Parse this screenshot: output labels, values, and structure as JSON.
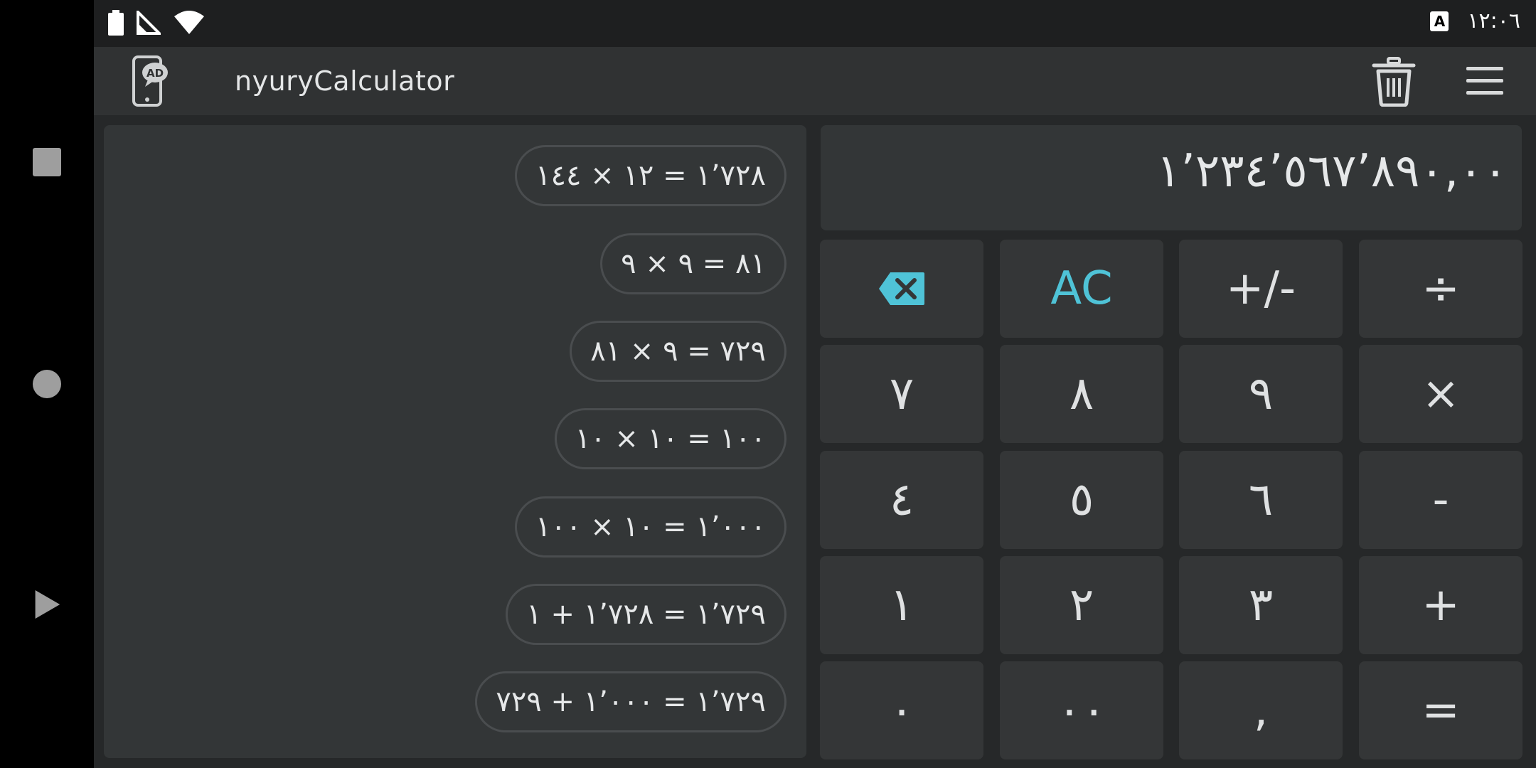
{
  "status_bar": {
    "time": "١٢:٠٦",
    "keyboard_badge": "A"
  },
  "app_bar": {
    "title": "nyuryCalculator",
    "ad_badge": "AD"
  },
  "history": [
    "١٬٧٢٨ = ١٢ × ١٤٤",
    "٨١ = ٩ × ٩",
    "٧٢٩ = ٩ × ٨١",
    "١٠٠ = ١٠ × ١٠",
    "١٬٠٠٠ = ١٠ × ١٠٠",
    "١٬٧٢٩ = ١٬٧٢٨ + ١",
    "١٬٧٢٩ = ١٬٠٠٠ + ٧٢٩"
  ],
  "display": {
    "value": "١٬٢٣٤٬٥٦٧٬٨٩٠,٠٠"
  },
  "keypad": {
    "ac": "AC",
    "plus_minus": "+/-",
    "divide": "÷",
    "seven": "٧",
    "eight": "٨",
    "nine": "٩",
    "multiply": "×",
    "four": "٤",
    "five": "٥",
    "six": "٦",
    "minus": "-",
    "one": "١",
    "two": "٢",
    "three": "٣",
    "plus": "+",
    "zero": "٠",
    "double_zero": "٠٠",
    "decimal": ",",
    "equals": "="
  },
  "colors": {
    "accent": "#4fc3d7",
    "key_background": "#343637",
    "panel_background": "#333637",
    "app_bar": "#303233"
  },
  "icons": [
    "battery-icon",
    "signal-icon",
    "wifi-icon",
    "keyboard-icon",
    "ad-phone-icon",
    "trash-icon",
    "menu-icon",
    "backspace-icon",
    "nav-square-icon",
    "nav-circle-icon",
    "nav-back-icon"
  ]
}
